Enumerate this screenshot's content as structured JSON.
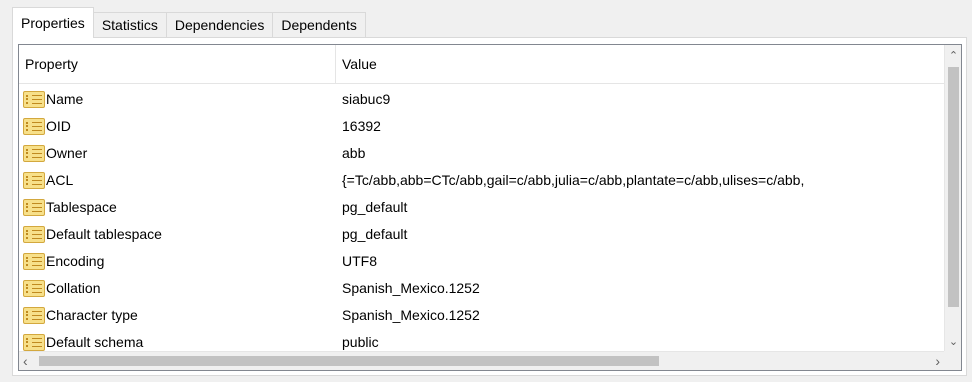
{
  "tabs": [
    {
      "label": "Properties",
      "active": true
    },
    {
      "label": "Statistics",
      "active": false
    },
    {
      "label": "Dependencies",
      "active": false
    },
    {
      "label": "Dependents",
      "active": false
    }
  ],
  "list": {
    "columns": [
      "Property",
      "Value"
    ],
    "rows": [
      {
        "property": "Name",
        "value": "siabuc9"
      },
      {
        "property": "OID",
        "value": "16392"
      },
      {
        "property": "Owner",
        "value": "abb"
      },
      {
        "property": "ACL",
        "value": "{=Tc/abb,abb=CTc/abb,gail=c/abb,julia=c/abb,plantate=c/abb,ulises=c/abb,"
      },
      {
        "property": "Tablespace",
        "value": "pg_default"
      },
      {
        "property": "Default tablespace",
        "value": "pg_default"
      },
      {
        "property": "Encoding",
        "value": "UTF8"
      },
      {
        "property": "Collation",
        "value": "Spanish_Mexico.1252"
      },
      {
        "property": "Character type",
        "value": "Spanish_Mexico.1252"
      },
      {
        "property": "Default schema",
        "value": "public"
      }
    ],
    "row_icon": "property-list-icon"
  },
  "scrollbars": {
    "up_icon": "chevron-up-icon",
    "down_icon": "chevron-down-icon",
    "left_icon": "chevron-left-icon",
    "right_icon": "chevron-right-icon"
  },
  "colors": {
    "window_bg": "#f0f0f0",
    "list_border": "#828790",
    "icon_fill": "#f7e08a",
    "scroll_thumb": "#c2c2c2"
  }
}
